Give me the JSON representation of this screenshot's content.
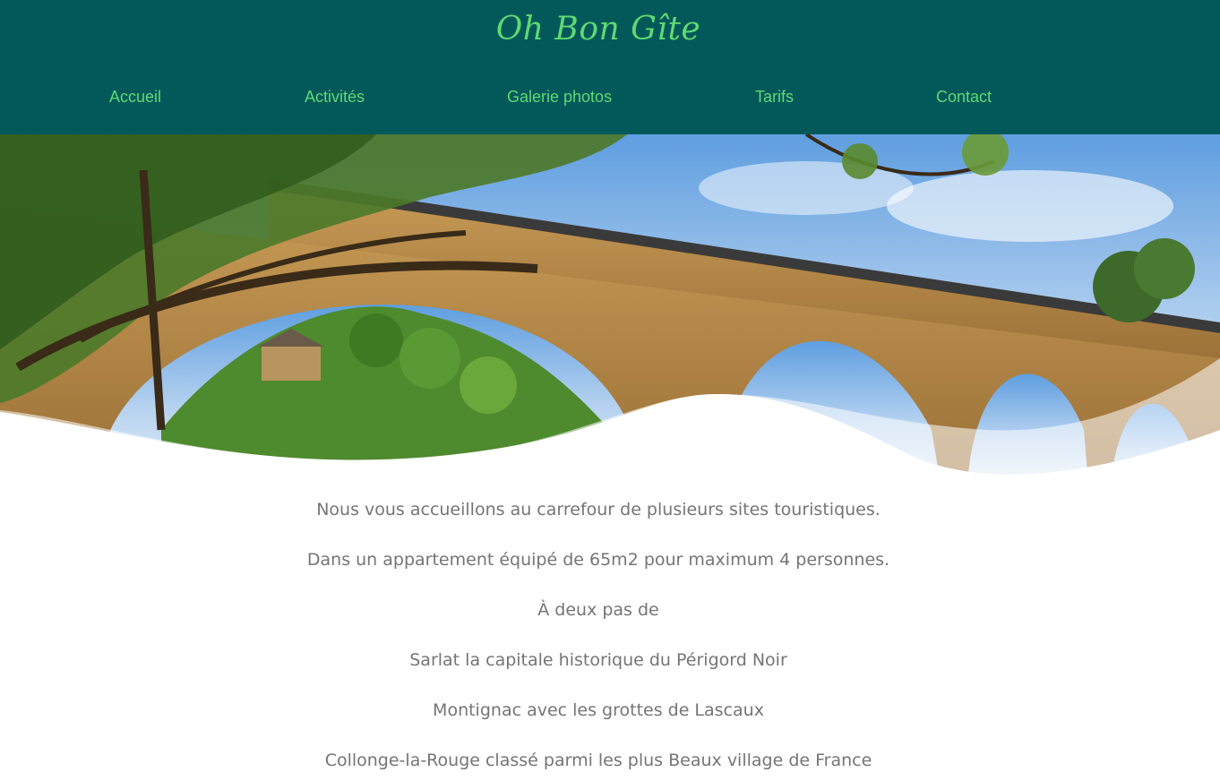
{
  "header": {
    "site_title": "Oh Bon Gîte",
    "background_color": "#03595a",
    "accent_color": "#5fd972"
  },
  "nav": {
    "items": [
      {
        "label": "Accueil"
      },
      {
        "label": "Activités"
      },
      {
        "label": "Galerie photos"
      },
      {
        "label": "Tarifs"
      },
      {
        "label": "Contact"
      }
    ]
  },
  "hero": {
    "image": "stone-arch-bridge-over-river-with-trees-and-village"
  },
  "content": {
    "paragraphs": [
      "Nous vous accueillons au carrefour de plusieurs sites touristiques.",
      "Dans un appartement équipé de 65m2 pour maximum 4 personnes.",
      "À deux pas de",
      "Sarlat la capitale historique du Périgord Noir",
      "Montignac avec les grottes de Lascaux",
      "Collonge-la-Rouge classé parmi les plus Beaux village de France"
    ]
  }
}
